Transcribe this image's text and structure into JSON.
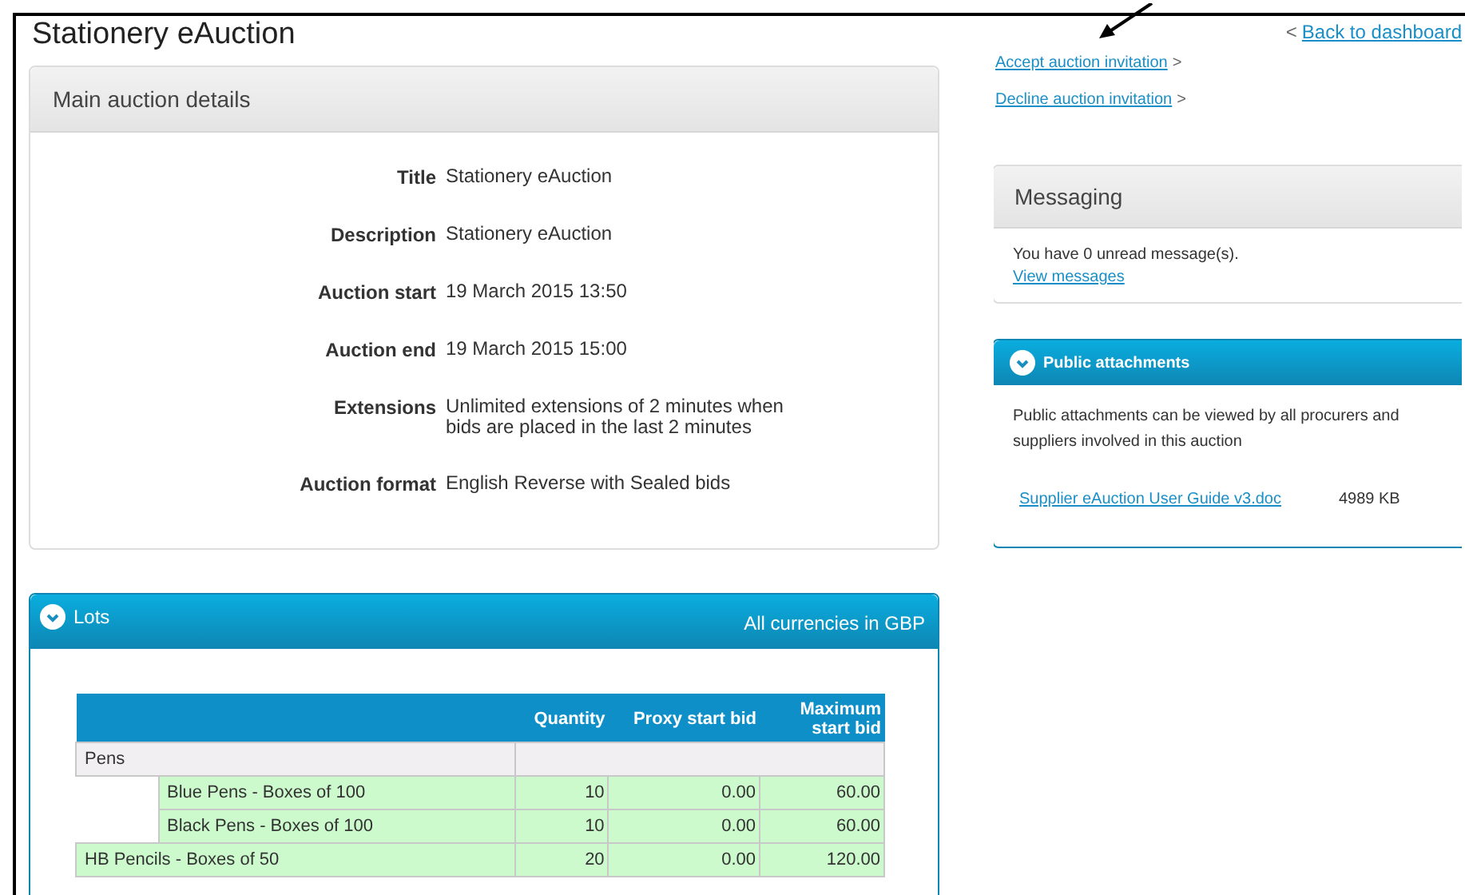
{
  "page": {
    "title": "Stationery eAuction"
  },
  "main_details": {
    "heading": "Main auction details",
    "fields": [
      {
        "label": "Title",
        "value": "Stationery eAuction"
      },
      {
        "label": "Description",
        "value": "Stationery eAuction"
      },
      {
        "label": "Auction start",
        "value": "19 March 2015 13:50"
      },
      {
        "label": "Auction end",
        "value": "19 March 2015 15:00"
      },
      {
        "label": "Extensions",
        "value": "Unlimited extensions of 2 minutes when bids are placed in the last 2 minutes"
      },
      {
        "label": "Auction format",
        "value": "English Reverse with Sealed bids"
      }
    ]
  },
  "lots": {
    "heading": "Lots",
    "expanded": true,
    "currency_note": "All currencies in GBP",
    "columns": [
      "Quantity",
      "Proxy start bid",
      "Maximum start bid"
    ],
    "rows": [
      {
        "name": "Pens",
        "children": [
          {
            "name": "Blue Pens - Boxes of 100",
            "quantity": "10",
            "proxy_start_bid": "0.00",
            "maximum_start_bid": "60.00"
          },
          {
            "name": "Black Pens - Boxes of 100",
            "quantity": "10",
            "proxy_start_bid": "0.00",
            "maximum_start_bid": "60.00"
          }
        ]
      },
      {
        "name": "HB Pencils - Boxes of 50",
        "quantity": "20",
        "proxy_start_bid": "0.00",
        "maximum_start_bid": "120.00"
      }
    ]
  },
  "back_link": {
    "arrow": "<",
    "label": "Back to dashboard"
  },
  "actions": [
    {
      "label": "Accept auction invitation",
      "arrow": ">"
    },
    {
      "label": "Decline auction invitation",
      "arrow": ">"
    }
  ],
  "messaging": {
    "heading": "Messaging",
    "text": "You have 0 unread message(s).",
    "link": "View messages"
  },
  "attachments": {
    "heading": "Public attachments",
    "expanded": true,
    "text": "Public attachments can be viewed by all procurers and suppliers involved in this auction",
    "files": [
      {
        "name": "Supplier eAuction User Guide v3.doc",
        "size": "4989 KB"
      }
    ]
  }
}
